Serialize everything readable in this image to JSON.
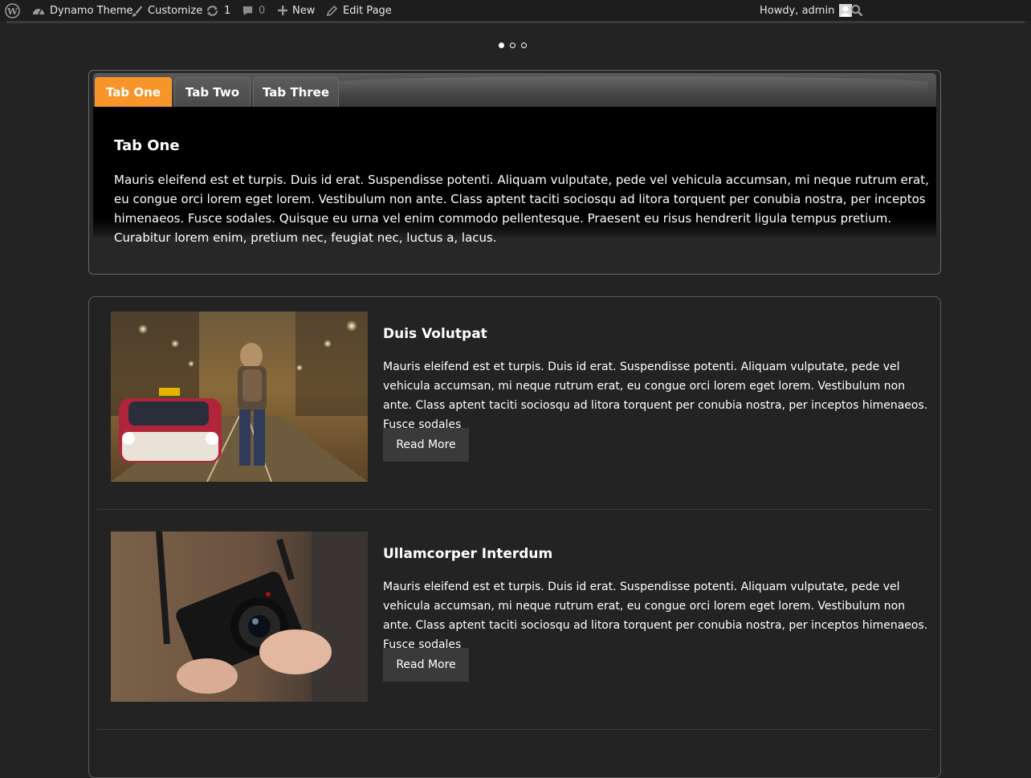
{
  "admin_bar": {
    "site_name": "Dynamo Theme",
    "customize": "Customize",
    "updates_count": "1",
    "comments_count": "0",
    "new_label": "New",
    "edit_page": "Edit Page",
    "howdy": "Howdy, admin"
  },
  "slider": {
    "dots": 3,
    "active": 0
  },
  "tabs": {
    "items": [
      {
        "label": "Tab One"
      },
      {
        "label": "Tab Two"
      },
      {
        "label": "Tab Three"
      }
    ],
    "active_index": 0,
    "content": {
      "title": "Tab One",
      "body": "Mauris eleifend est et turpis. Duis id erat. Suspendisse potenti. Aliquam vulputate, pede vel vehicula accumsan, mi neque rutrum erat, eu congue orci lorem eget lorem. Vestibulum non ante. Class aptent taciti sociosqu ad litora torquent per conubia nostra, per inceptos himenaeos. Fusce sodales. Quisque eu urna vel enim commodo pellentesque. Praesent eu risus hendrerit ligula tempus pretium. Curabitur lorem enim, pretium nec, feugiat nec, luctus a, lacus."
    }
  },
  "posts": [
    {
      "title": "Duis Volutpat",
      "excerpt": "Mauris eleifend est et turpis. Duis id erat. Suspendisse potenti. Aliquam vulputate, pede vel vehicula accumsan, mi neque rutrum erat, eu congue orci lorem eget lorem. Vestibulum non ante. Class aptent taciti sociosqu ad litora torquent per conubia nostra, per inceptos himenaeos. Fusce sodales",
      "button": "Read More",
      "image": "city-street-taxi-photo"
    },
    {
      "title": "Ullamcorper Interdum",
      "excerpt": "Mauris eleifend est et turpis. Duis id erat. Suspendisse potenti. Aliquam vulputate, pede vel vehicula accumsan, mi neque rutrum erat, eu congue orci lorem eget lorem. Vestibulum non ante. Class aptent taciti sociosqu ad litora torquent per conubia nostra, per inceptos himenaeos. Fusce sodales",
      "button": "Read More",
      "image": "camera-hands-photo"
    }
  ],
  "colors": {
    "accent": "#f7952b",
    "background": "#232323",
    "admin_bar": "#1d1d1d"
  }
}
